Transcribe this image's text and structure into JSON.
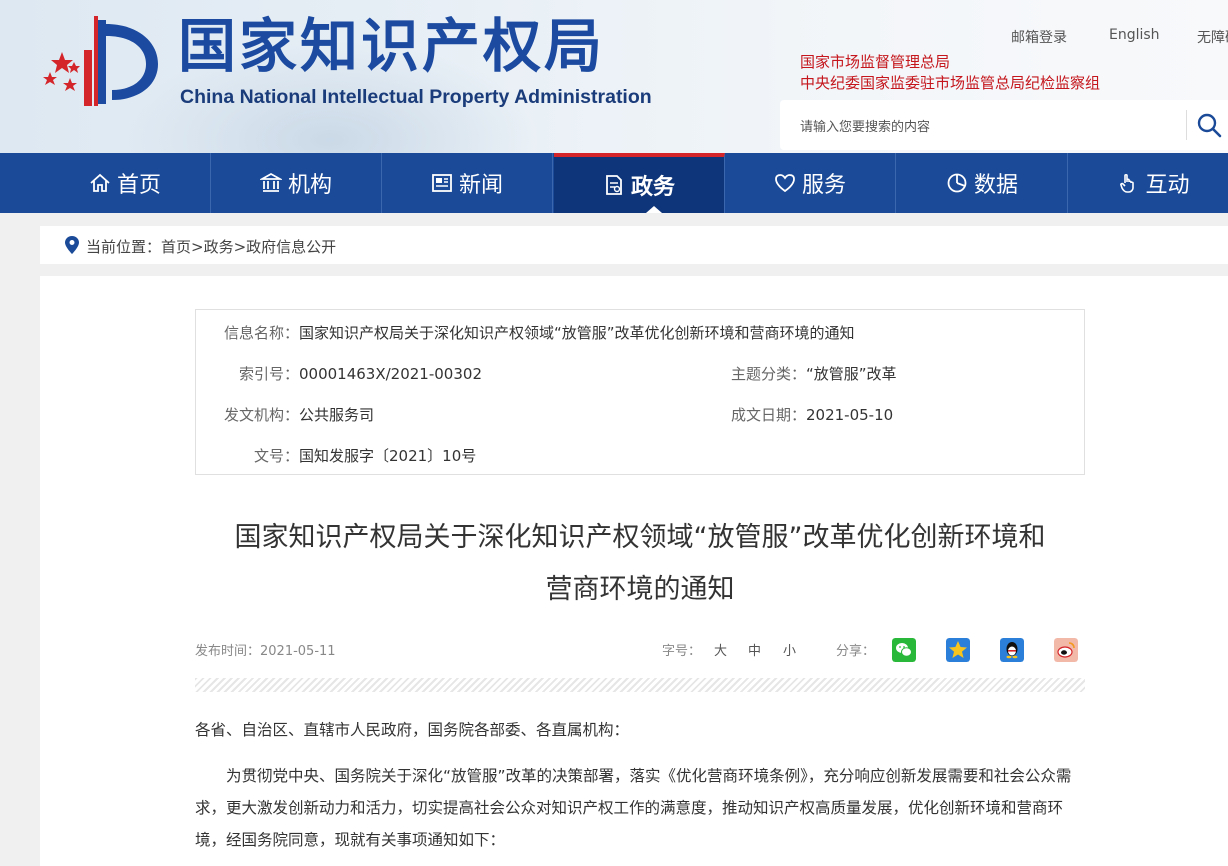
{
  "header": {
    "title": "国家知识产权局",
    "subtitle": "China National Intellectual Property Administration",
    "top_links": [
      "邮箱登录",
      "English",
      "无障碍"
    ],
    "org_lines": [
      "国家市场监督管理总局",
      "中央纪委国家监委驻市场监管总局纪检监察组"
    ],
    "search_placeholder": "请输入您要搜索的内容"
  },
  "nav": {
    "items": [
      {
        "label": "首页",
        "icon": "home-icon"
      },
      {
        "label": "机构",
        "icon": "institution-icon"
      },
      {
        "label": "新闻",
        "icon": "newspaper-icon"
      },
      {
        "label": "政务",
        "icon": "document-icon"
      },
      {
        "label": "服务",
        "icon": "heart-hand-icon"
      },
      {
        "label": "数据",
        "icon": "pie-chart-icon"
      },
      {
        "label": "互动",
        "icon": "hand-pointer-icon"
      }
    ],
    "active_index": 3
  },
  "breadcrumb": {
    "prefix": "当前位置：",
    "path": "首页>政务>政府信息公开"
  },
  "info": {
    "name_label": "信息名称：",
    "name_value": "国家知识产权局关于深化知识产权领域“放管服”改革优化创新环境和营商环境的通知",
    "index_label": "索引号：",
    "index_value": "00001463X/2021-00302",
    "topic_label": "主题分类：",
    "topic_value": "“放管服”改革",
    "issuer_label": "发文机构：",
    "issuer_value": "公共服务司",
    "date_label": "成文日期：",
    "date_value": "2021-05-10",
    "docno_label": "文号：",
    "docno_value": "国知发服字〔2021〕10号"
  },
  "article": {
    "title_line1": "国家知识产权局关于深化知识产权领域“放管服”改革优化创新环境和",
    "title_line2": "营商环境的通知",
    "publish_label": "发布时间：",
    "publish_date": "2021-05-11",
    "fontsize_label": "字号：",
    "fontsize_options": [
      "大",
      "中",
      "小"
    ],
    "share_label": "分享：",
    "share_icons": [
      "wechat-icon",
      "qzone-icon",
      "qq-icon",
      "weibo-icon"
    ],
    "salutation": "各省、自治区、直辖市人民政府，国务院各部委、各直属机构：",
    "paragraph1": "为贯彻党中央、国务院关于深化“放管服”改革的决策部署，落实《优化营商环境条例》，充分响应创新发展需要和社会公众需求，更大激发创新动力和活力，切实提高社会公众对知识产权工作的满意度，推动知识产权高质量发展，优化创新环境和营商环境，经国务院同意，现就有关事项通知如下："
  },
  "colors": {
    "nav_bg": "#1a4a98",
    "nav_active_bg": "#0e3579",
    "accent_red": "#c4161c",
    "title_blue": "#1b4aa0"
  }
}
